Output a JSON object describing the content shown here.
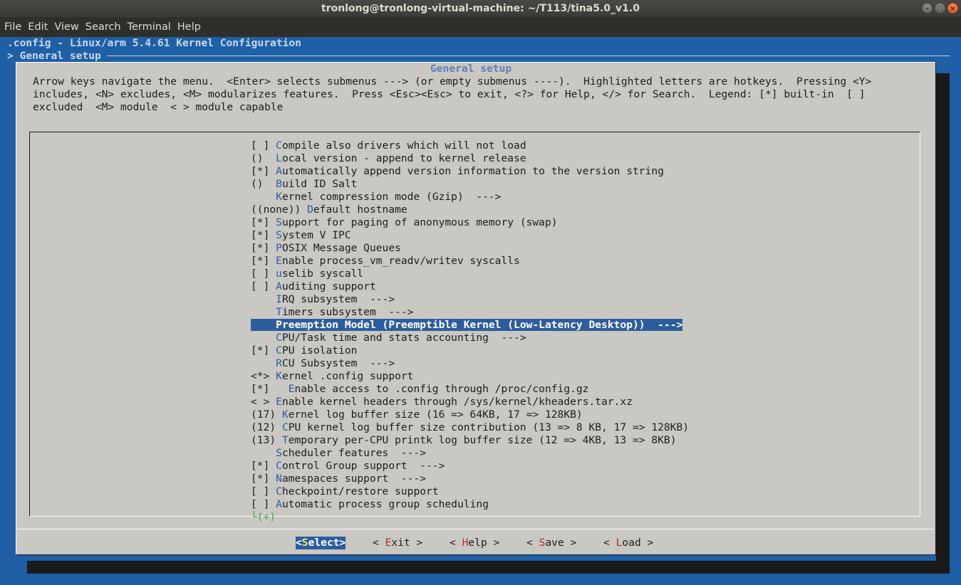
{
  "window": {
    "title": "tronlong@tronlong-virtual-machine: ~/T113/tina5.0_v1.0",
    "buttons": [
      "–",
      "□",
      "×"
    ]
  },
  "menubar": [
    "File",
    "Edit",
    "View",
    "Search",
    "Terminal",
    "Help"
  ],
  "header": {
    "config_line": ".config - Linux/arm 5.4.61 Kernel Configuration",
    "breadcrumb": "> General setup"
  },
  "dialog": {
    "title": "General setup",
    "help_lines": [
      "Arrow keys navigate the menu.  <Enter> selects submenus ---> (or empty submenus ----).  Highlighted letters are hotkeys.  Pressing <Y>",
      "includes, <N> excludes, <M> modularizes features.  Press <Esc><Esc> to exit, <?> for Help, </> for Search.  Legend: [*] built-in  [ ]",
      "excluded  <M> module  < > module capable"
    ],
    "items": [
      {
        "prefix": "[ ] ",
        "hotkey": "C",
        "rest": "ompile also drivers which will not load"
      },
      {
        "prefix": "()  ",
        "hotkey": "L",
        "rest": "ocal version - append to kernel release"
      },
      {
        "prefix": "[*] ",
        "hotkey": "A",
        "rest": "utomatically append version information to the version string"
      },
      {
        "prefix": "()  ",
        "hotkey": "B",
        "rest": "uild ID Salt"
      },
      {
        "prefix": "    ",
        "hotkey": "K",
        "rest": "ernel compression mode (Gzip)  --->"
      },
      {
        "prefix": "((none)) ",
        "hotkey": "D",
        "rest": "efault hostname"
      },
      {
        "prefix": "[*] ",
        "hotkey": "S",
        "rest": "upport for paging of anonymous memory (swap)"
      },
      {
        "prefix": "[*] ",
        "hotkey": "S",
        "rest": "ystem V IPC"
      },
      {
        "prefix": "[*] ",
        "hotkey": "P",
        "rest": "OSIX Message Queues"
      },
      {
        "prefix": "[*] ",
        "hotkey": "E",
        "rest": "nable process_vm_readv/writev syscalls"
      },
      {
        "prefix": "[ ] ",
        "hotkey": "u",
        "rest": "selib syscall"
      },
      {
        "prefix": "[ ] ",
        "hotkey": "A",
        "rest": "uditing support"
      },
      {
        "prefix": "    ",
        "hotkey": "I",
        "rest": "RQ subsystem  --->"
      },
      {
        "prefix": "    ",
        "hotkey": "T",
        "rest": "imers subsystem  --->"
      },
      {
        "prefix": "    ",
        "hotkey": "P",
        "rest": "reemption Model (Preemptible Kernel (Low-Latency Desktop))  --->",
        "selected": true
      },
      {
        "prefix": "    ",
        "hotkey": "C",
        "rest": "PU/Task time and stats accounting  --->"
      },
      {
        "prefix": "[*] ",
        "hotkey": "C",
        "rest": "PU isolation"
      },
      {
        "prefix": "    ",
        "hotkey": "R",
        "rest": "CU Subsystem  --->"
      },
      {
        "prefix": "<*> ",
        "hotkey": "K",
        "rest": "ernel .config support"
      },
      {
        "prefix": "[*]   ",
        "hotkey": "E",
        "rest": "nable access to .config through /proc/config.gz"
      },
      {
        "prefix": "< > ",
        "hotkey": "E",
        "rest": "nable kernel headers through /sys/kernel/kheaders.tar.xz"
      },
      {
        "prefix": "(17) ",
        "hotkey": "K",
        "rest": "ernel log buffer size (16 => 64KB, 17 => 128KB)"
      },
      {
        "prefix": "(12) ",
        "hotkey": "C",
        "rest": "PU kernel log buffer size contribution (13 => 8 KB, 17 => 128KB)"
      },
      {
        "prefix": "(13) ",
        "hotkey": "T",
        "rest": "emporary per-CPU printk log buffer size (12 => 4KB, 13 => 8KB)"
      },
      {
        "prefix": "    ",
        "hotkey": "S",
        "rest": "cheduler features  --->"
      },
      {
        "prefix": "[*] ",
        "hotkey": "C",
        "rest": "ontrol Group support  --->"
      },
      {
        "prefix": "[*] ",
        "hotkey": "N",
        "rest": "amespaces support  --->"
      },
      {
        "prefix": "[ ] ",
        "hotkey": "C",
        "rest": "heckpoint/restore support"
      },
      {
        "prefix": "[ ] ",
        "hotkey": "A",
        "rest": "utomatic process group scheduling"
      }
    ],
    "more_indicator": "└(+)",
    "buttons": [
      {
        "pre": "<",
        "hotkey": "S",
        "post": "elect>",
        "active": true
      },
      {
        "pre": "< ",
        "hotkey": "E",
        "post": "xit >"
      },
      {
        "pre": "< ",
        "hotkey": "H",
        "post": "elp >"
      },
      {
        "pre": "< ",
        "hotkey": "S",
        "post": "ave >"
      },
      {
        "pre": "< ",
        "hotkey": "L",
        "post": "oad >"
      }
    ]
  }
}
